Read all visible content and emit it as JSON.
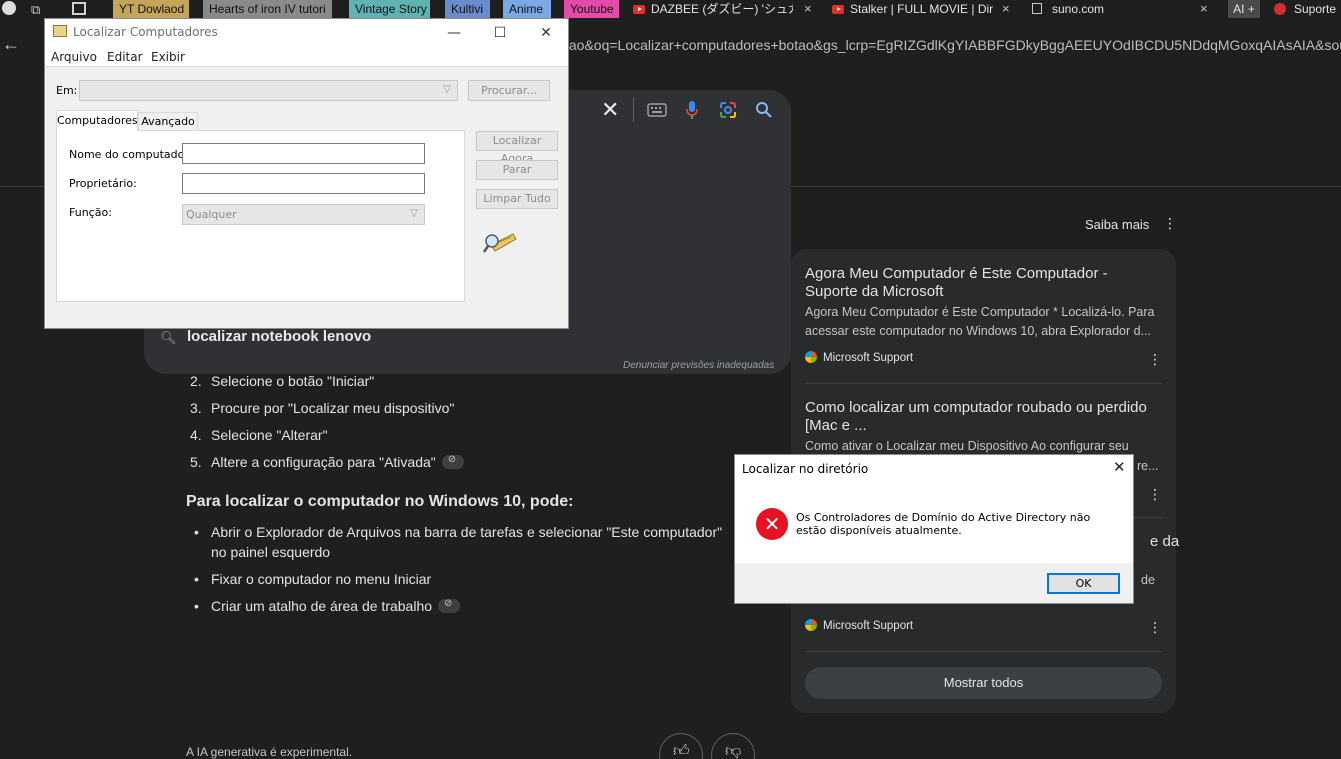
{
  "bookmarks": [
    {
      "label": "YT Dowlaod",
      "bg": "#c6a45a"
    },
    {
      "label": "Hearts of iron IV tutori",
      "bg": "#8a8a8a"
    },
    {
      "label": "Vintage Story",
      "bg": "#5fb3b3"
    },
    {
      "label": "Kultivi",
      "bg": "#6a8ccf"
    },
    {
      "label": "Anime",
      "bg": "#7aa8e6"
    },
    {
      "label": "Youtube",
      "bg": "#e24ca8"
    }
  ],
  "tabs": [
    {
      "label": "DAZBEE (ダズビー) 'シュガー"
    },
    {
      "label": "Stalker | FULL MOVIE | Dir"
    },
    {
      "label": "suno.com"
    },
    {
      "label": "AI +"
    },
    {
      "label": "Suporte"
    }
  ],
  "address": {
    "url": "tao&oq=Localizar+computadores+botao&gs_lcrp=EgRIZGdlKgYIABBFGDkyBggAEEUYOdIBCDU5NDdqMGoxqAIAsAIA&sourc"
  },
  "search": {
    "suggestion": "localizar notebook lenovo",
    "report_link": "Denunciar previsões inadequadas"
  },
  "overview": {
    "steps": [
      {
        "n": "2.",
        "text": "Selecione o botão \"Iniciar\"",
        "chip": false
      },
      {
        "n": "3.",
        "text": "Procure por \"Localizar meu dispositivo\"",
        "chip": false
      },
      {
        "n": "4.",
        "text": "Selecione \"Alterar\"",
        "chip": false
      },
      {
        "n": "5.",
        "text": "Altere a configuração para \"Ativada\"",
        "chip": true
      }
    ],
    "heading": "Para localizar o computador no Windows 10, pode:",
    "bullets": [
      {
        "text": "Abrir o Explorador de Arquivos na barra de tarefas e selecionar \"Este computador\"",
        "text2": "no painel esquerdo",
        "chip": false
      },
      {
        "text": "Fixar o computador no menu Iniciar",
        "chip": false
      },
      {
        "text": "Criar um atalho de área de trabalho",
        "chip": true
      }
    ],
    "disclaimer": "A IA generativa é experimental."
  },
  "sources": {
    "learn_more": "Saiba mais",
    "items": [
      {
        "title": "Agora Meu Computador é Este Computador - Suporte da Microsoft",
        "snippet": "Agora Meu Computador é Este Computador * Localizá-lo. Para acessar este computador no Windows 10, abra Explorador d...",
        "site": "Microsoft Support"
      },
      {
        "title": "Como localizar um computador roubado ou perdido [Mac e ...",
        "snippet": "Como ativar o Localizar meu Dispositivo Ao configurar seu",
        "snippet2": "re..."
      },
      {
        "title_tail": "e da",
        "snippet_tail": "de",
        "site": "Microsoft Support"
      }
    ],
    "show_all": "Mostrar todos"
  },
  "find_dialog": {
    "title": "Localizar Computadores",
    "menu": [
      "Arquivo",
      "Editar",
      "Exibir"
    ],
    "in_label": "Em:",
    "browse_button": "Procurar...",
    "tabs": [
      "Computadores",
      "Avançado"
    ],
    "fields": {
      "computer_name_label": "Nome do computador:",
      "computer_name_value": "",
      "owner_label": "Proprietário:",
      "owner_value": "",
      "role_label": "Função:",
      "role_value": "Qualquer"
    },
    "buttons": {
      "find_now": "Localizar Agora",
      "stop": "Parar",
      "clear_all": "Limpar Tudo"
    }
  },
  "error_dialog": {
    "title": "Localizar no diretório",
    "message": "Os Controladores de Domínio do Active Directory não estão disponíveis atualmente.",
    "ok": "OK"
  }
}
